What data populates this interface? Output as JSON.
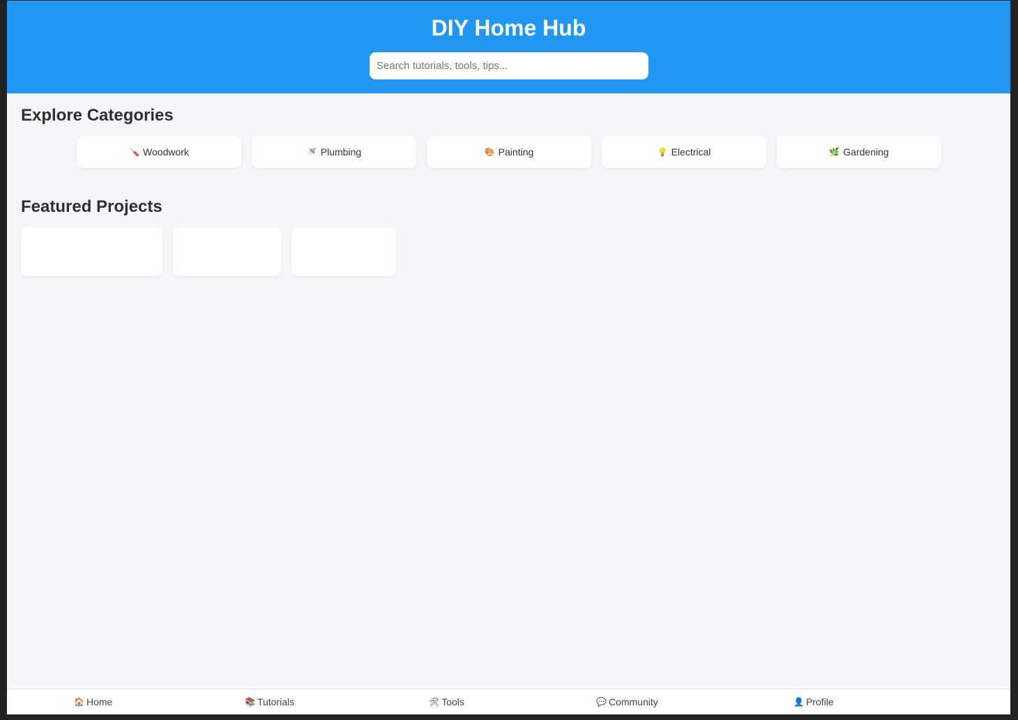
{
  "header": {
    "title": "DIY Home Hub",
    "search_placeholder": "Search tutorials, tools, tips..."
  },
  "categories_section": {
    "title": "Explore Categories",
    "items": [
      {
        "icon": "🪛",
        "label": "Woodwork"
      },
      {
        "icon": "🚿",
        "label": "Plumbing"
      },
      {
        "icon": "🎨",
        "label": "Painting"
      },
      {
        "icon": "💡",
        "label": "Electrical"
      },
      {
        "icon": "🌿",
        "label": "Gardening"
      }
    ]
  },
  "projects_section": {
    "title": "Featured Projects"
  },
  "bottom_nav": {
    "items": [
      {
        "icon": "🏠",
        "label": "Home"
      },
      {
        "icon": "📚",
        "label": "Tutorials"
      },
      {
        "icon": "🛠",
        "label": "Tools"
      },
      {
        "icon": "💬",
        "label": "Community"
      },
      {
        "icon": "👤",
        "label": "Profile"
      }
    ]
  },
  "colors": {
    "header_bg": "#2196f3",
    "page_bg": "#f4f6fa",
    "card_bg": "#ffffff"
  }
}
